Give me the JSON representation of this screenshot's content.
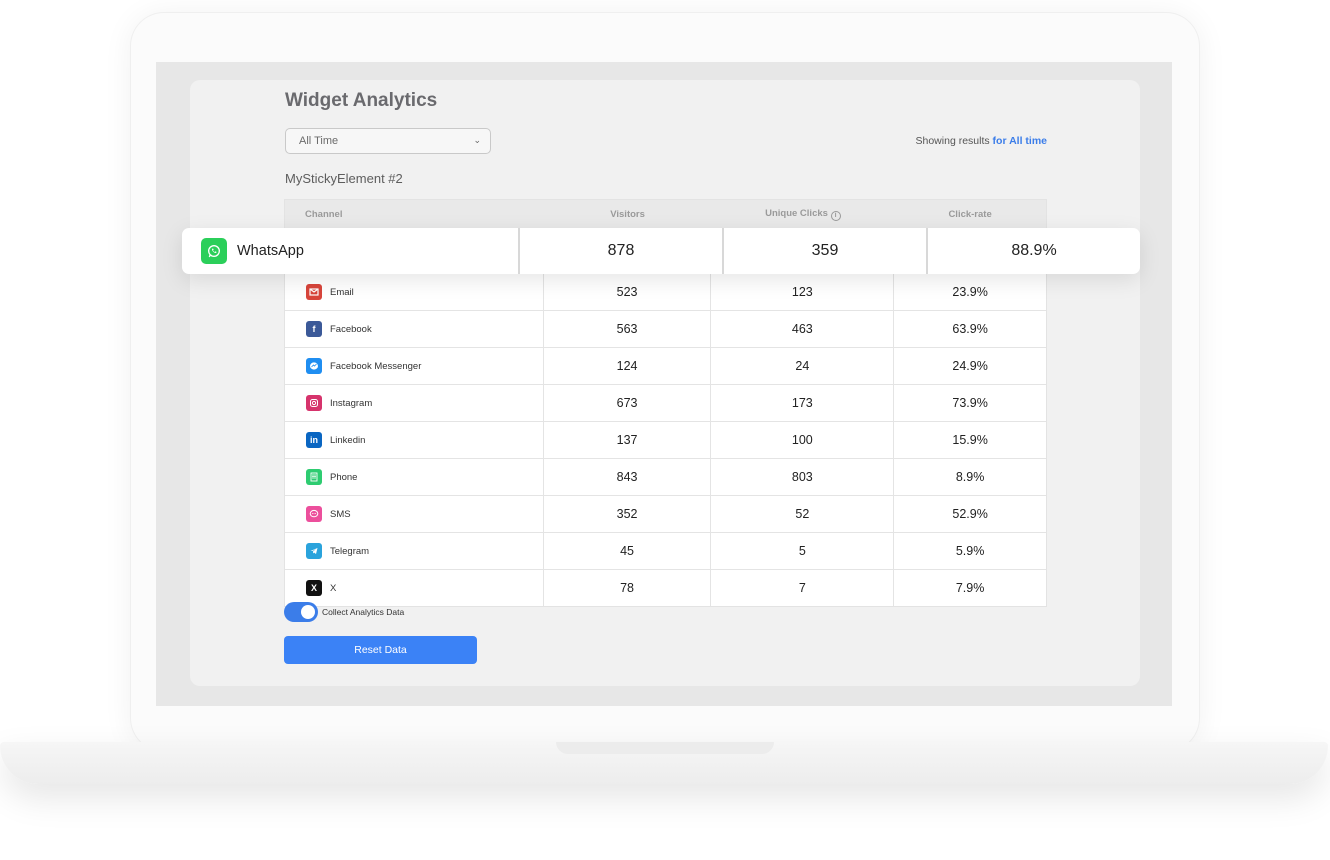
{
  "page": {
    "title": "Widget Analytics",
    "period_select": {
      "value": "All Time"
    },
    "showing_prefix": "Showing results",
    "showing_highlight": "for All time",
    "element_name": "MyStickyElement #2"
  },
  "table": {
    "headers": [
      "Channel",
      "Visitors",
      "Unique Clicks",
      "Click-rate"
    ],
    "highlight_row": {
      "channel": "WhatsApp",
      "visitors": "878",
      "clicks": "359",
      "rate": "88.9%",
      "icon": "whatsapp-icon",
      "color": "#2bcf5a"
    },
    "rows": [
      {
        "channel": "Email",
        "visitors": "523",
        "clicks": "123",
        "rate": "23.9%",
        "icon": "email-icon",
        "color": "#d8453b"
      },
      {
        "channel": "Facebook",
        "visitors": "563",
        "clicks": "463",
        "rate": "63.9%",
        "icon": "facebook-icon",
        "color": "#3b5998"
      },
      {
        "channel": "Facebook Messenger",
        "visitors": "124",
        "clicks": "24",
        "rate": "24.9%",
        "icon": "messenger-icon",
        "color": "#1f8ef1"
      },
      {
        "channel": "Instagram",
        "visitors": "673",
        "clicks": "173",
        "rate": "73.9%",
        "icon": "instagram-icon",
        "color": "#d6336c"
      },
      {
        "channel": "Linkedin",
        "visitors": "137",
        "clicks": "100",
        "rate": "15.9%",
        "icon": "linkedin-icon",
        "color": "#0a66c2"
      },
      {
        "channel": "Phone",
        "visitors": "843",
        "clicks": "803",
        "rate": "8.9%",
        "icon": "phone-icon",
        "color": "#2ecc71"
      },
      {
        "channel": "SMS",
        "visitors": "352",
        "clicks": "52",
        "rate": "52.9%",
        "icon": "sms-icon",
        "color": "#ec4f9c"
      },
      {
        "channel": "Telegram",
        "visitors": "45",
        "clicks": "5",
        "rate": "5.9%",
        "icon": "telegram-icon",
        "color": "#2aa3dc"
      },
      {
        "channel": "X",
        "visitors": "78",
        "clicks": "7",
        "rate": "7.9%",
        "icon": "x-icon",
        "color": "#111111"
      }
    ]
  },
  "controls": {
    "collect_label": "Collect Analytics Data",
    "collect_on": true,
    "reset_label": "Reset Data"
  },
  "colors": {
    "accent": "#3b7de9",
    "button": "#3b82f6"
  }
}
